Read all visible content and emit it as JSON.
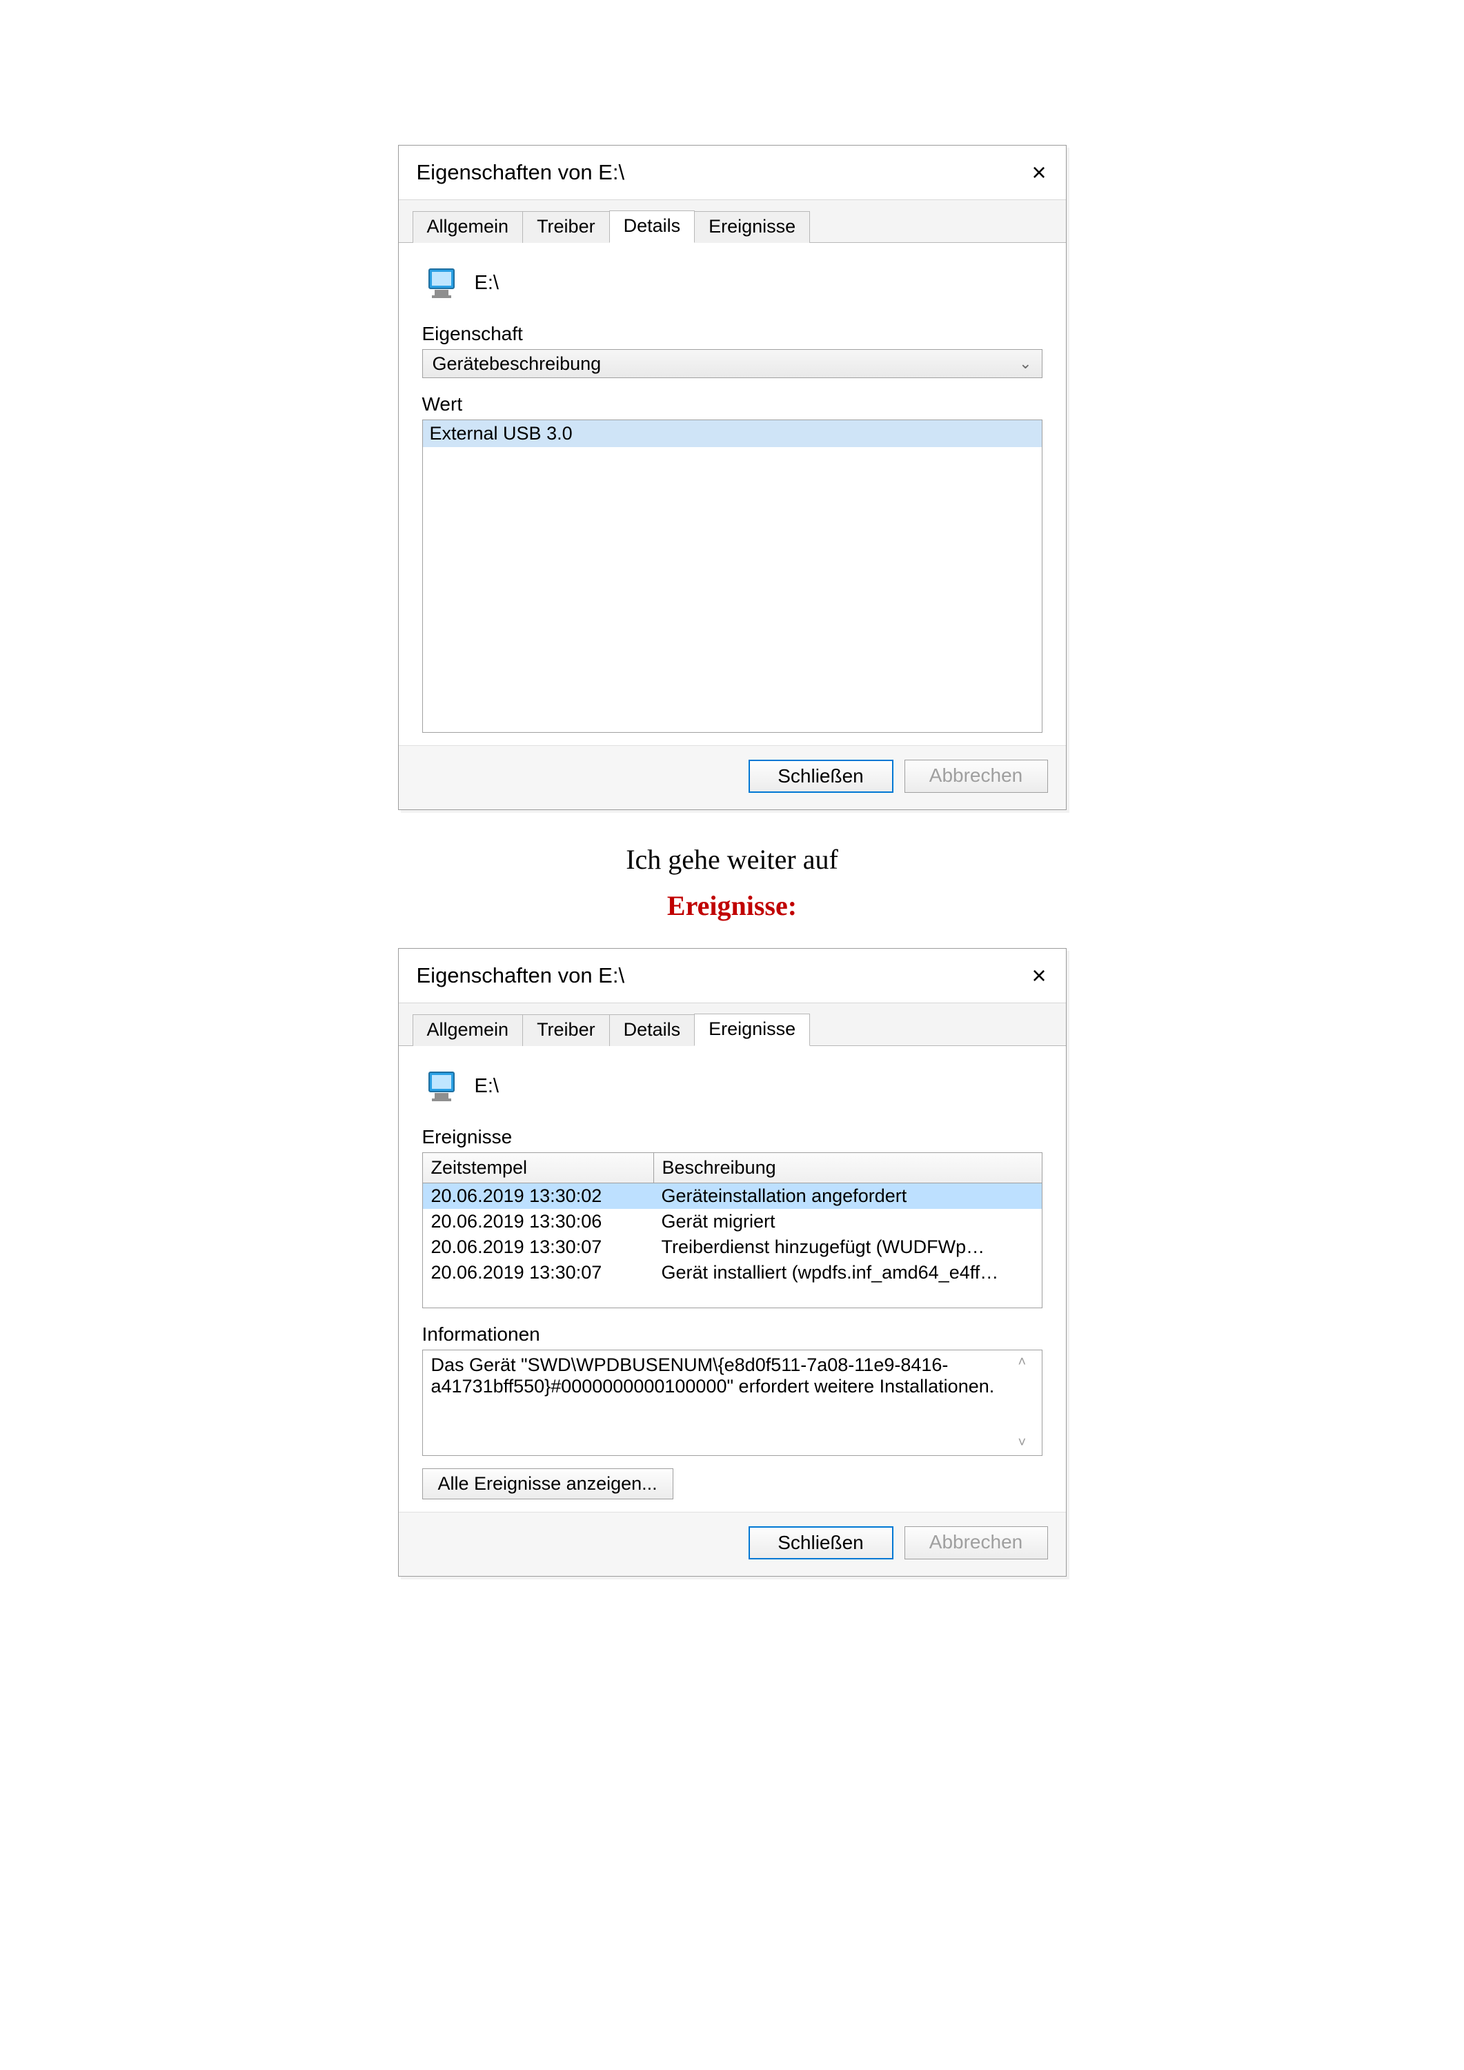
{
  "narration": {
    "line1": "Ich gehe weiter auf",
    "line2": "Ereignisse:"
  },
  "dialog1": {
    "title": "Eigenschaften von E:\\",
    "tabs": {
      "allgemein": "Allgemein",
      "treiber": "Treiber",
      "details": "Details",
      "ereignisse": "Ereignisse"
    },
    "active_tab": "details",
    "device_name": "E:\\",
    "property_label": "Eigenschaft",
    "property_selected": "Gerätebeschreibung",
    "value_label": "Wert",
    "value_items": [
      "External USB 3.0"
    ],
    "buttons": {
      "close": "Schließen",
      "cancel": "Abbrechen"
    }
  },
  "dialog2": {
    "title": "Eigenschaften von E:\\",
    "tabs": {
      "allgemein": "Allgemein",
      "treiber": "Treiber",
      "details": "Details",
      "ereignisse": "Ereignisse"
    },
    "active_tab": "ereignisse",
    "device_name": "E:\\",
    "events_label": "Ereignisse",
    "events_columns": {
      "timestamp": "Zeitstempel",
      "description": "Beschreibung"
    },
    "events": [
      {
        "ts": "20.06.2019 13:30:02",
        "desc": "Geräteinstallation angefordert",
        "selected": true
      },
      {
        "ts": "20.06.2019 13:30:06",
        "desc": "Gerät migriert",
        "selected": false
      },
      {
        "ts": "20.06.2019 13:30:07",
        "desc": "Treiberdienst hinzugefügt (WUDFWp…",
        "selected": false
      },
      {
        "ts": "20.06.2019 13:30:07",
        "desc": "Gerät installiert (wpdfs.inf_amd64_e4ff…",
        "selected": false
      }
    ],
    "info_label": "Informationen",
    "info_text": "Das Gerät \"SWD\\WPDBUSENUM\\{e8d0f511-7a08-11e9-8416-a41731bff550}#0000000000100000\" erfordert weitere Installationen.",
    "all_events_button": "Alle Ereignisse anzeigen...",
    "buttons": {
      "close": "Schließen",
      "cancel": "Abbrechen"
    }
  }
}
